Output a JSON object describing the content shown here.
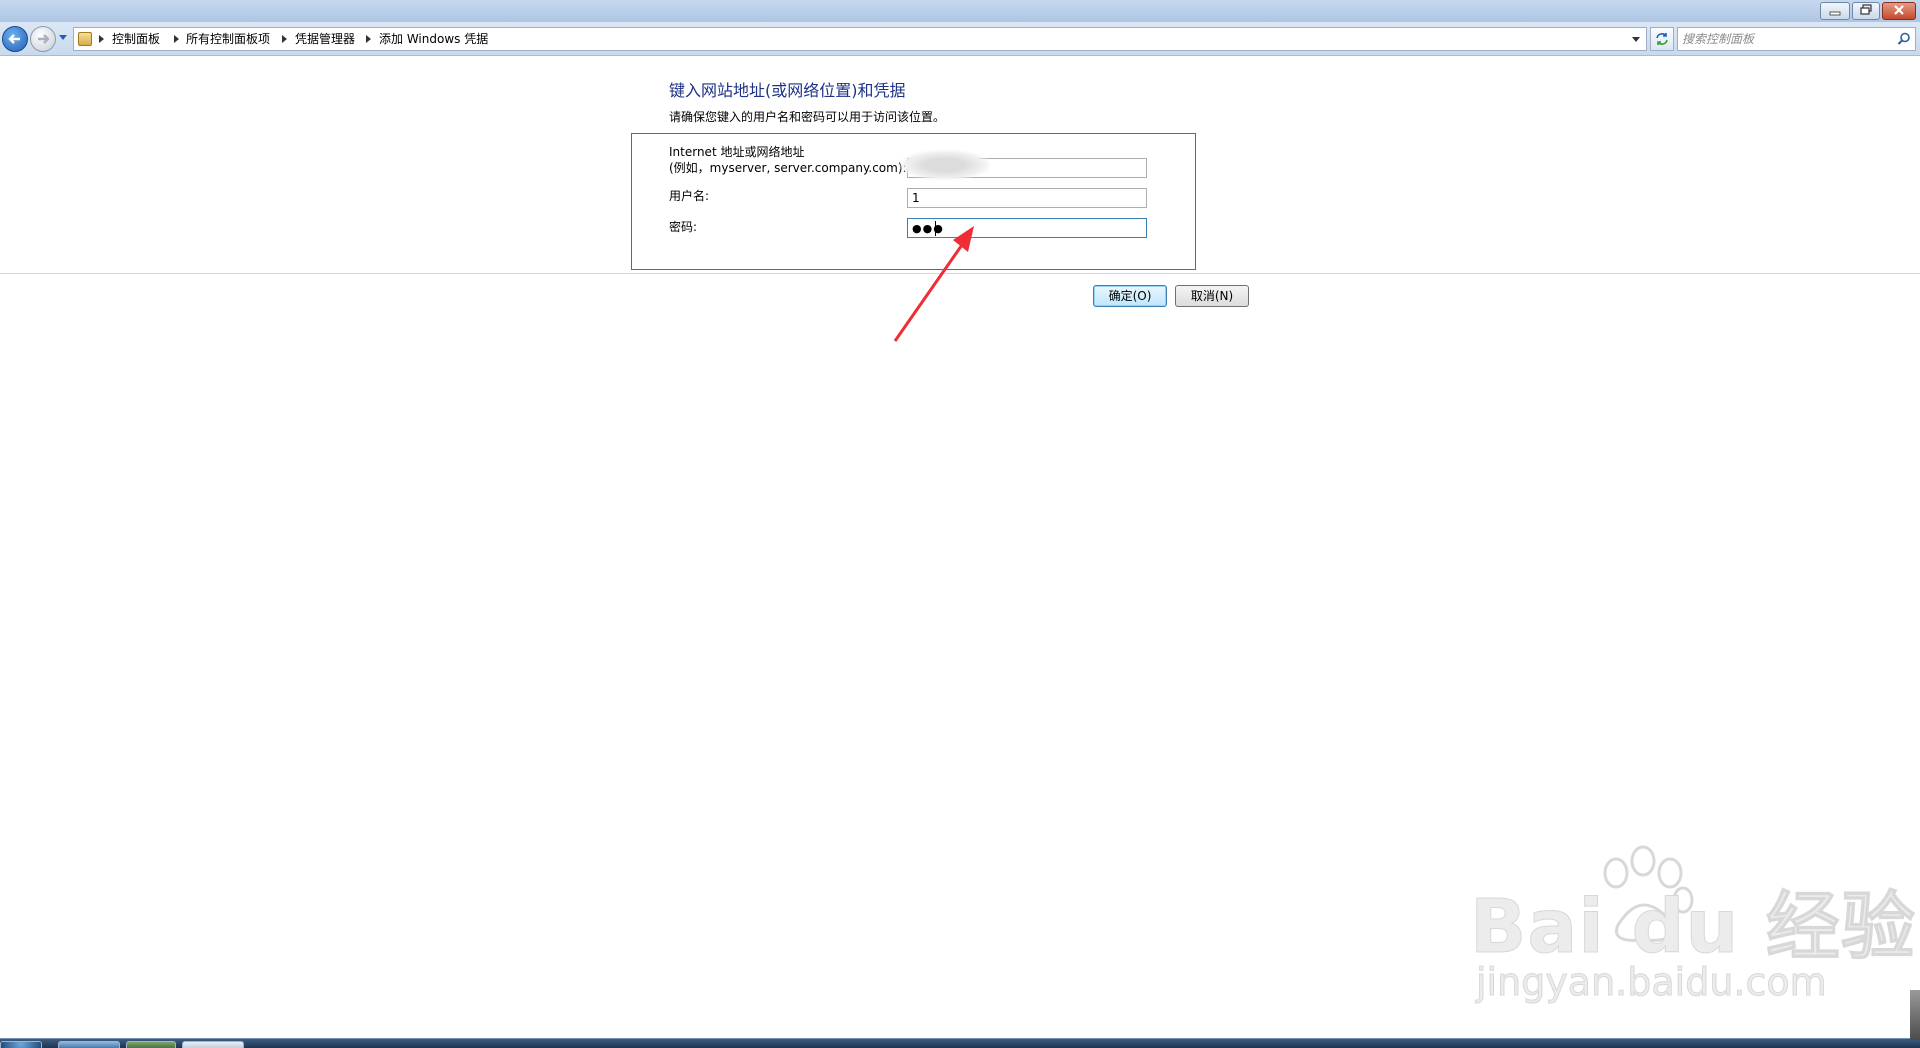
{
  "window": {
    "controls": [
      "minimize-icon",
      "restore-icon",
      "close-icon"
    ]
  },
  "address_bar": {
    "crumbs": [
      "控制面板",
      "所有控制面板项",
      "凭据管理器",
      "添加 Windows 凭据"
    ],
    "search_placeholder": "搜索控制面板"
  },
  "form": {
    "heading": "键入网站地址(或网络位置)和凭据",
    "subtext": "请确保您键入的用户名和密码可以用于访问该位置。",
    "address_label_line1": "Internet 地址或网络地址",
    "address_label_line2": "(例如，myserver, server.company.com):",
    "address_value": "",
    "username_label": "用户名:",
    "username_value": "1",
    "password_label": "密码:",
    "password_mask": "●●●"
  },
  "buttons": {
    "ok": "确定(O)",
    "cancel": "取消(N)"
  },
  "watermark": {
    "brand": "Bai du 经验",
    "url": "jingyan.baidu.com"
  },
  "colors": {
    "heading": "#1e3287",
    "highlight_border": "#ee2d35",
    "arrow": "#ee2d35"
  }
}
